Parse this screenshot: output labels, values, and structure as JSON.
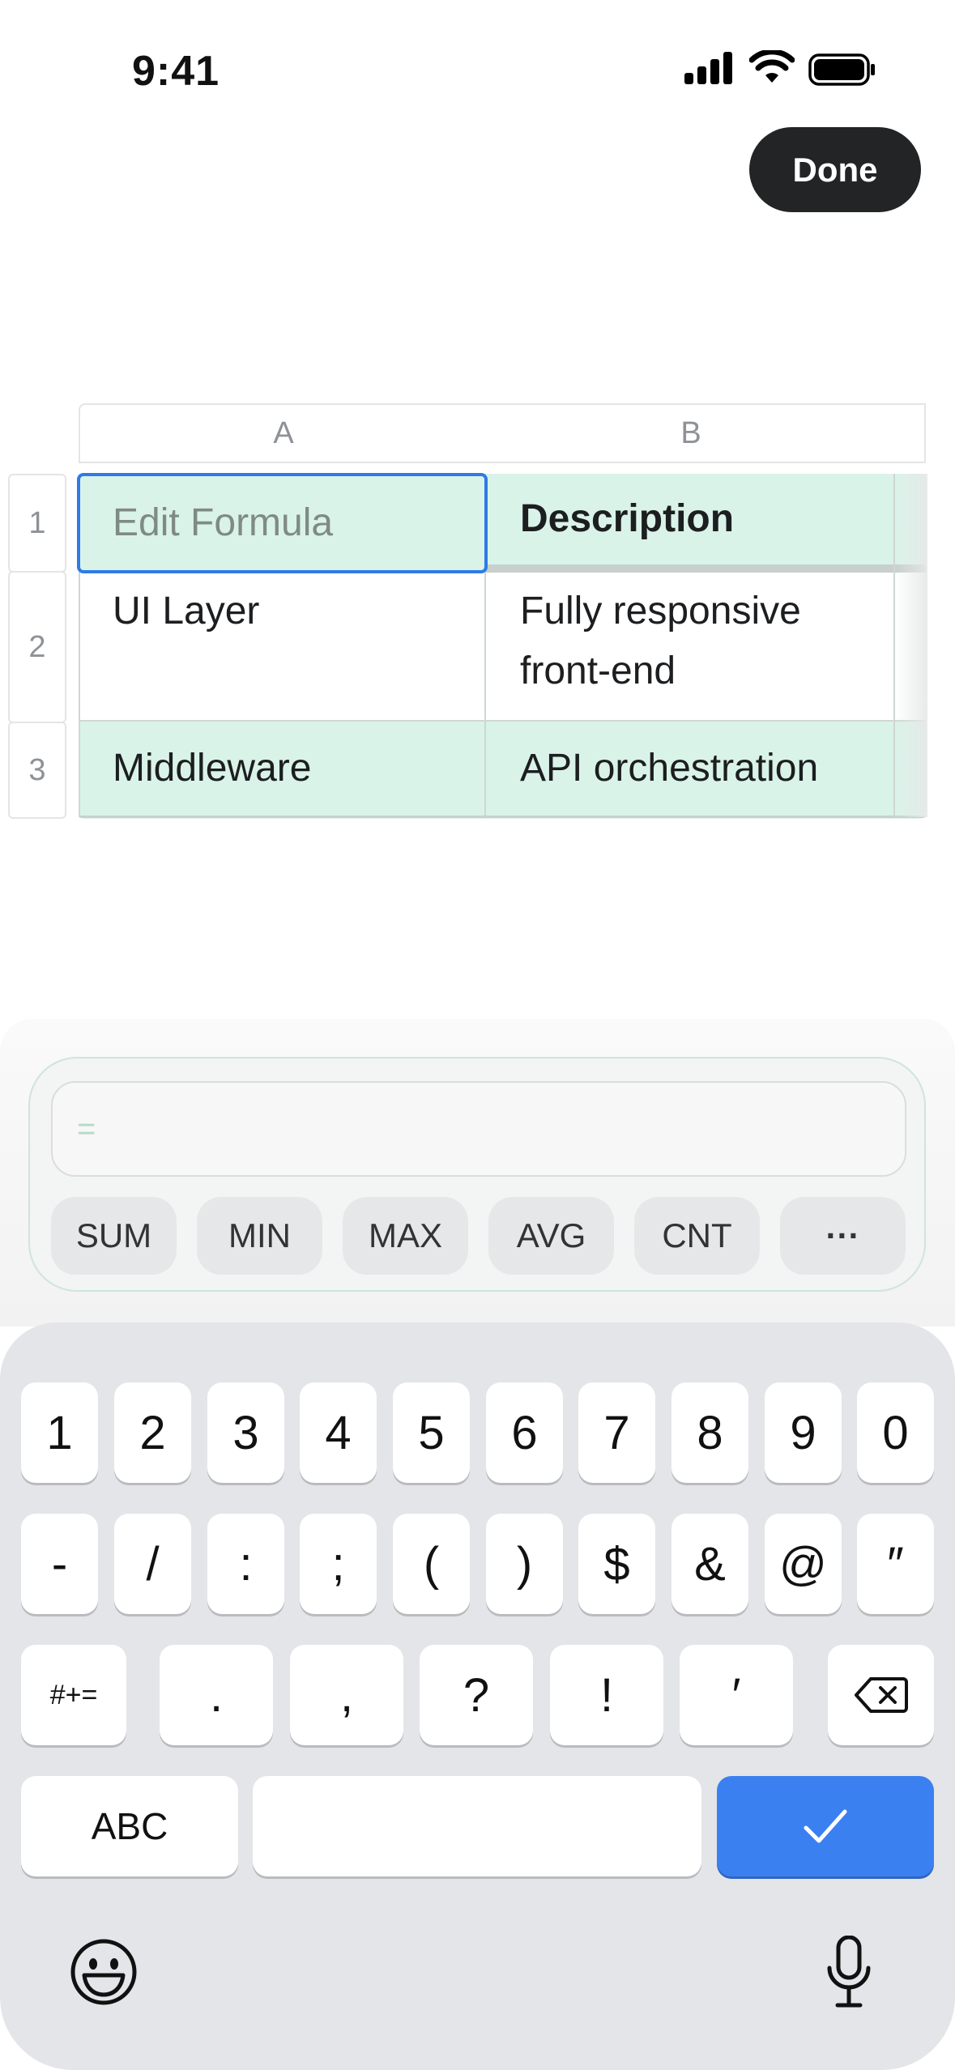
{
  "status": {
    "time": "9:41"
  },
  "header": {
    "done_label": "Done"
  },
  "sheet": {
    "columns": [
      "A",
      "B"
    ],
    "rows": [
      {
        "num": "1",
        "a_placeholder": "Edit Formula",
        "b": "Description"
      },
      {
        "num": "2",
        "a": "UI Layer",
        "b_line1": "Fully responsive",
        "b_line2": "front-end"
      },
      {
        "num": "3",
        "a": "Middleware",
        "b": "API orchestration"
      }
    ]
  },
  "formula": {
    "placeholder": "=",
    "functions": [
      "SUM",
      "MIN",
      "MAX",
      "AVG",
      "CNT",
      "···"
    ]
  },
  "keyboard": {
    "row1": [
      "1",
      "2",
      "3",
      "4",
      "5",
      "6",
      "7",
      "8",
      "9",
      "0"
    ],
    "row2": [
      "-",
      "/",
      ":",
      ";",
      "(",
      ")",
      "$",
      "&",
      "@",
      "″"
    ],
    "row3": [
      ".",
      ",",
      "?",
      "!",
      "′"
    ],
    "symbols_label": "#+=",
    "abc_label": "ABC",
    "accent": "#3b80f0"
  }
}
